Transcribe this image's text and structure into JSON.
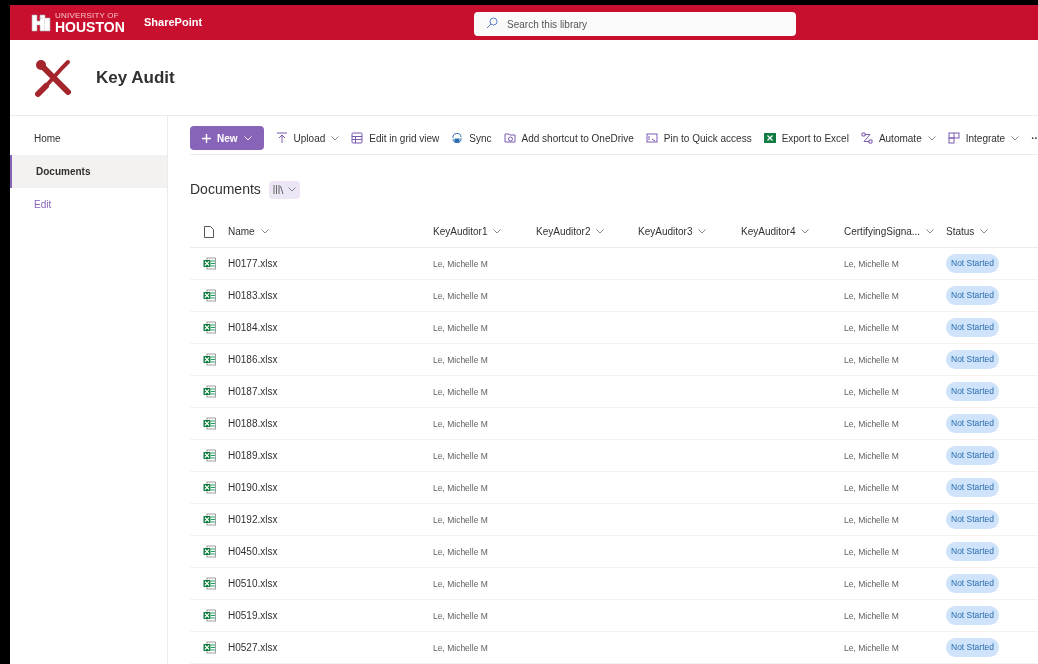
{
  "suite_bar": {
    "logo_top": "UNIVERSITY OF",
    "logo_bottom": "HOUSTON",
    "app_name": "SharePoint",
    "search": {
      "placeholder": "Search this library"
    }
  },
  "site": {
    "title": "Key Audit"
  },
  "nav": [
    {
      "label": "Home",
      "selected": false,
      "kind": "link"
    },
    {
      "label": "Documents",
      "selected": true,
      "kind": "link"
    },
    {
      "label": "Edit",
      "selected": false,
      "kind": "edit"
    }
  ],
  "command_bar": {
    "new_label": "New",
    "items": [
      {
        "label": "Upload",
        "kind": "upload",
        "dropdown": true
      },
      {
        "label": "Edit in grid view",
        "kind": "grid",
        "dropdown": false
      },
      {
        "label": "Sync",
        "kind": "sync",
        "dropdown": false
      },
      {
        "label": "Add shortcut to OneDrive",
        "kind": "shortcut",
        "dropdown": false
      },
      {
        "label": "Pin to Quick access",
        "kind": "pin",
        "dropdown": false
      },
      {
        "label": "Export to Excel",
        "kind": "excel",
        "dropdown": false
      },
      {
        "label": "Automate",
        "kind": "automate",
        "dropdown": true
      },
      {
        "label": "Integrate",
        "kind": "integrate",
        "dropdown": true
      }
    ],
    "more": "··"
  },
  "library": {
    "title": "Documents"
  },
  "table": {
    "columns": [
      "Name",
      "KeyAuditor1",
      "KeyAuditor2",
      "KeyAuditor3",
      "KeyAuditor4",
      "CertifyingSigna...",
      "Status"
    ],
    "rows": [
      {
        "name": "H0177.xlsx",
        "key_auditor_1": "Le, Michelle M",
        "certifying": "Le, Michelle M",
        "status": "Not Started"
      },
      {
        "name": "H0183.xlsx",
        "key_auditor_1": "Le, Michelle M",
        "certifying": "Le, Michelle M",
        "status": "Not Started"
      },
      {
        "name": "H0184.xlsx",
        "key_auditor_1": "Le, Michelle M",
        "certifying": "Le, Michelle M",
        "status": "Not Started"
      },
      {
        "name": "H0186.xlsx",
        "key_auditor_1": "Le, Michelle M",
        "certifying": "Le, Michelle M",
        "status": "Not Started"
      },
      {
        "name": "H0187.xlsx",
        "key_auditor_1": "Le, Michelle M",
        "certifying": "Le, Michelle M",
        "status": "Not Started"
      },
      {
        "name": "H0188.xlsx",
        "key_auditor_1": "Le, Michelle M",
        "certifying": "Le, Michelle M",
        "status": "Not Started"
      },
      {
        "name": "H0189.xlsx",
        "key_auditor_1": "Le, Michelle M",
        "certifying": "Le, Michelle M",
        "status": "Not Started"
      },
      {
        "name": "H0190.xlsx",
        "key_auditor_1": "Le, Michelle M",
        "certifying": "Le, Michelle M",
        "status": "Not Started"
      },
      {
        "name": "H0192.xlsx",
        "key_auditor_1": "Le, Michelle M",
        "certifying": "Le, Michelle M",
        "status": "Not Started"
      },
      {
        "name": "H0450.xlsx",
        "key_auditor_1": "Le, Michelle M",
        "certifying": "Le, Michelle M",
        "status": "Not Started"
      },
      {
        "name": "H0510.xlsx",
        "key_auditor_1": "Le, Michelle M",
        "certifying": "Le, Michelle M",
        "status": "Not Started"
      },
      {
        "name": "H0519.xlsx",
        "key_auditor_1": "Le, Michelle M",
        "certifying": "Le, Michelle M",
        "status": "Not Started"
      },
      {
        "name": "H0527.xlsx",
        "key_auditor_1": "Le, Michelle M",
        "certifying": "Le, Michelle M",
        "status": "Not Started"
      }
    ]
  }
}
